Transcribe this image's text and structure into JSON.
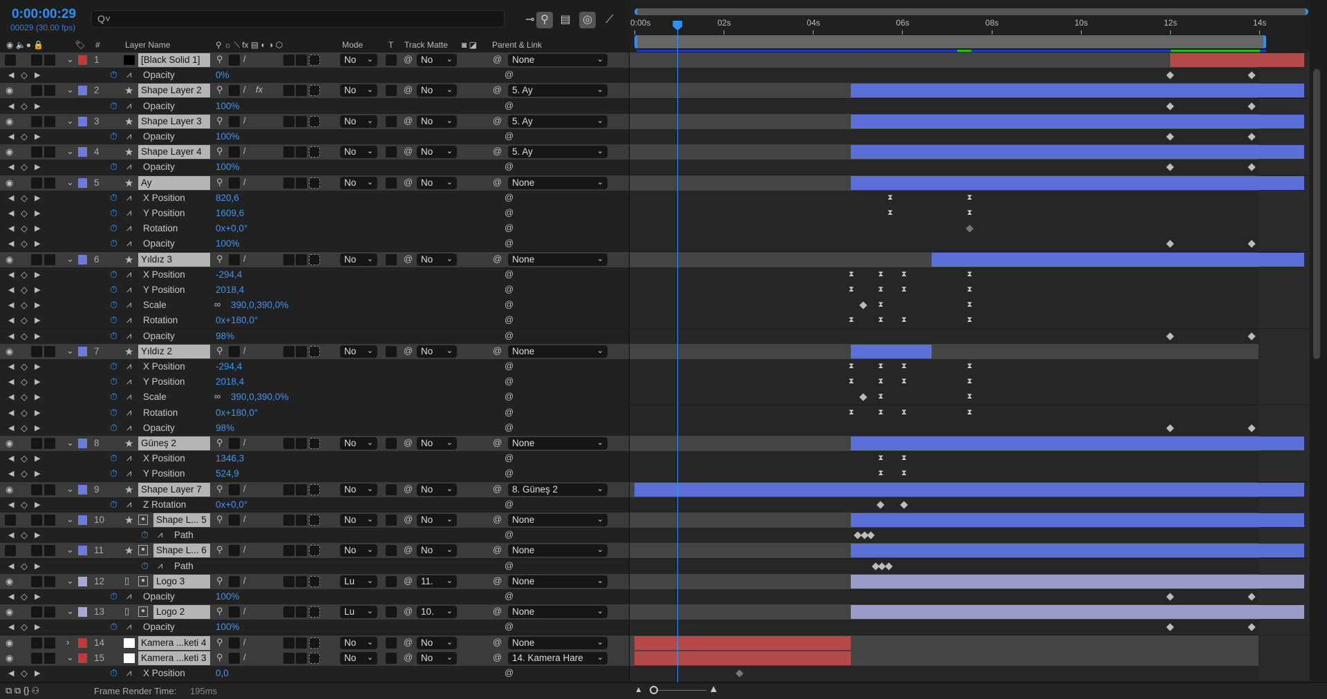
{
  "header": {
    "timecode": "0:00:00:29",
    "frames_fps": "00029 (30.00 fps)",
    "search_placeholder": "Q˅"
  },
  "columns": {
    "hash": "#",
    "layer_name": "Layer Name",
    "mode": "Mode",
    "t": "T",
    "track_matte": "Track Matte",
    "parent_link": "Parent & Link"
  },
  "ruler": {
    "labels": [
      "0:00s",
      "02s",
      "04s",
      "06s",
      "08s",
      "10s",
      "12s",
      "14s"
    ],
    "current_time_s": 0.967,
    "comp_end_s": 15
  },
  "colors": {
    "accent": "#2e8ff0",
    "red": "#b64848",
    "blue": "#5b6fd8",
    "lavender": "#9b9bc8"
  },
  "rows": [
    {
      "type": "layer",
      "num": "1",
      "name": "[Black Solid 1]",
      "label": "#c0393b",
      "src": "solid-black",
      "eye": false,
      "twirl": "v",
      "mode": "No",
      "matte": "No",
      "parent": "None",
      "bar": [
        12,
        15
      ],
      "barColor": "#b64848"
    },
    {
      "type": "prop",
      "name": "Opacity",
      "value": "0%",
      "keys": [
        [
          12,
          "d"
        ],
        [
          13.83,
          "d"
        ]
      ]
    },
    {
      "type": "layer",
      "num": "2",
      "name": "Shape Layer 2",
      "label": "#6b7be0",
      "src": "star",
      "eye": true,
      "twirl": "v",
      "mode": "No",
      "matte": "No",
      "parent": "5. Ay",
      "bar": [
        4.85,
        15
      ],
      "barColor": "#5b6fd8",
      "fx": true
    },
    {
      "type": "prop",
      "name": "Opacity",
      "value": "100%",
      "keys": [
        [
          12,
          "d"
        ],
        [
          13.83,
          "d"
        ]
      ]
    },
    {
      "type": "layer",
      "num": "3",
      "name": "Shape Layer 3",
      "label": "#6b7be0",
      "src": "star",
      "eye": true,
      "twirl": "v",
      "mode": "No",
      "matte": "No",
      "parent": "5. Ay",
      "bar": [
        4.85,
        15
      ],
      "barColor": "#5b6fd8"
    },
    {
      "type": "prop",
      "name": "Opacity",
      "value": "100%",
      "keys": [
        [
          12,
          "d"
        ],
        [
          13.83,
          "d"
        ]
      ]
    },
    {
      "type": "layer",
      "num": "4",
      "name": "Shape Layer 4",
      "label": "#6b7be0",
      "src": "star",
      "eye": true,
      "twirl": "v",
      "mode": "No",
      "matte": "No",
      "parent": "5. Ay",
      "bar": [
        4.85,
        15
      ],
      "barColor": "#5b6fd8"
    },
    {
      "type": "prop",
      "name": "Opacity",
      "value": "100%",
      "keys": [
        [
          12,
          "d"
        ],
        [
          13.83,
          "d"
        ]
      ]
    },
    {
      "type": "layer",
      "num": "5",
      "name": "Ay",
      "label": "#6b7be0",
      "src": "star",
      "eye": true,
      "twirl": "v",
      "mode": "No",
      "matte": "No",
      "parent": "None",
      "bar": [
        4.85,
        15
      ],
      "barColor": "#5b6fd8"
    },
    {
      "type": "prop",
      "name": "X Position",
      "value": "820,6",
      "keys": [
        [
          5.73,
          "h"
        ],
        [
          7.51,
          "h"
        ]
      ]
    },
    {
      "type": "prop",
      "name": "Y Position",
      "value": "1609,6",
      "keys": [
        [
          5.73,
          "h"
        ],
        [
          7.51,
          "h"
        ]
      ]
    },
    {
      "type": "prop",
      "name": "Rotation",
      "value": "0x+0,0°",
      "keys": [
        [
          7.51,
          "dg"
        ]
      ]
    },
    {
      "type": "prop",
      "name": "Opacity",
      "value": "100%",
      "keys": [
        [
          12,
          "d"
        ],
        [
          13.83,
          "d"
        ]
      ]
    },
    {
      "type": "layer",
      "num": "6",
      "name": "Yıldız 3",
      "label": "#6b7be0",
      "src": "star",
      "eye": true,
      "twirl": "v",
      "mode": "No",
      "matte": "No",
      "parent": "None",
      "bar": [
        6.66,
        15
      ],
      "barColor": "#5b6fd8"
    },
    {
      "type": "prop",
      "name": "X Position",
      "value": "-294,4",
      "keys": [
        [
          4.86,
          "h"
        ],
        [
          5.52,
          "h"
        ],
        [
          6.04,
          "h"
        ],
        [
          7.51,
          "h"
        ]
      ]
    },
    {
      "type": "prop",
      "name": "Y Position",
      "value": "2018,4",
      "keys": [
        [
          4.86,
          "h"
        ],
        [
          5.52,
          "h"
        ],
        [
          6.04,
          "h"
        ],
        [
          7.51,
          "h"
        ]
      ]
    },
    {
      "type": "prop",
      "name": "Scale",
      "value": "390,0,390,0%",
      "link": true,
      "keys": [
        [
          5.13,
          "d"
        ],
        [
          5.52,
          "h"
        ],
        [
          7.51,
          "h"
        ]
      ]
    },
    {
      "type": "prop",
      "name": "Rotation",
      "value": "0x+180,0°",
      "keys": [
        [
          4.86,
          "h"
        ],
        [
          5.52,
          "h"
        ],
        [
          6.04,
          "h"
        ],
        [
          7.51,
          "h"
        ]
      ]
    },
    {
      "type": "prop",
      "name": "Opacity",
      "value": "98%",
      "keys": [
        [
          12,
          "d"
        ],
        [
          13.83,
          "d"
        ]
      ]
    },
    {
      "type": "layer",
      "num": "7",
      "name": "Yıldız 2",
      "label": "#6b7be0",
      "src": "star",
      "eye": true,
      "twirl": "v",
      "mode": "No",
      "matte": "No",
      "parent": "None",
      "bar": [
        4.85,
        6.66
      ],
      "barColor": "#5b6fd8"
    },
    {
      "type": "prop",
      "name": "X Position",
      "value": "-294,4",
      "keys": [
        [
          4.86,
          "h"
        ],
        [
          5.52,
          "h"
        ],
        [
          6.04,
          "h"
        ],
        [
          7.51,
          "h"
        ]
      ]
    },
    {
      "type": "prop",
      "name": "Y Position",
      "value": "2018,4",
      "keys": [
        [
          4.86,
          "h"
        ],
        [
          5.52,
          "h"
        ],
        [
          6.04,
          "h"
        ],
        [
          7.51,
          "h"
        ]
      ]
    },
    {
      "type": "prop",
      "name": "Scale",
      "value": "390,0,390,0%",
      "link": true,
      "keys": [
        [
          5.13,
          "d"
        ],
        [
          5.52,
          "h"
        ],
        [
          7.51,
          "h"
        ]
      ]
    },
    {
      "type": "prop",
      "name": "Rotation",
      "value": "0x+180,0°",
      "keys": [
        [
          4.86,
          "h"
        ],
        [
          5.52,
          "h"
        ],
        [
          6.04,
          "h"
        ],
        [
          7.51,
          "h"
        ]
      ]
    },
    {
      "type": "prop",
      "name": "Opacity",
      "value": "98%",
      "keys": [
        [
          12,
          "d"
        ],
        [
          13.83,
          "d"
        ]
      ]
    },
    {
      "type": "layer",
      "num": "8",
      "name": "Güneş 2",
      "label": "#6b7be0",
      "src": "star",
      "eye": true,
      "twirl": "v",
      "mode": "No",
      "matte": "No",
      "parent": "None",
      "bar": [
        4.85,
        15
      ],
      "barColor": "#5b6fd8"
    },
    {
      "type": "prop",
      "name": "X Position",
      "value": "1346,3",
      "keys": [
        [
          5.52,
          "h"
        ],
        [
          6.04,
          "h"
        ]
      ]
    },
    {
      "type": "prop",
      "name": "Y Position",
      "value": "524,9",
      "keys": [
        [
          5.52,
          "h"
        ],
        [
          6.04,
          "h"
        ]
      ]
    },
    {
      "type": "layer",
      "num": "9",
      "name": "Shape Layer 7",
      "label": "#6b7be0",
      "src": "star",
      "eye": true,
      "twirl": "v",
      "mode": "No",
      "matte": "No",
      "parent": "8. Güneş 2",
      "bar": [
        0,
        15
      ],
      "barColor": "#5b6fd8"
    },
    {
      "type": "prop",
      "name": "Z Rotation",
      "value": "0x+0,0°",
      "keys": [
        [
          5.52,
          "d"
        ],
        [
          6.04,
          "d"
        ]
      ]
    },
    {
      "type": "layer",
      "num": "10",
      "name": "Shape L... 5",
      "label": "#6b7be0",
      "src": "star",
      "eye": false,
      "twirl": "v",
      "mode": "No",
      "matte": "No",
      "parent": "None",
      "bar": [
        4.85,
        15
      ],
      "barColor": "#5b6fd8"
    },
    {
      "type": "prop",
      "name": "Path",
      "value": "",
      "nested": true,
      "keys": [
        [
          5.0,
          "d"
        ],
        [
          5.15,
          "d"
        ],
        [
          5.3,
          "d"
        ]
      ]
    },
    {
      "type": "layer",
      "num": "11",
      "name": "Shape L... 6",
      "label": "#6b7be0",
      "src": "star",
      "eye": false,
      "twirl": "v",
      "mode": "No",
      "matte": "No",
      "parent": "None",
      "bar": [
        4.85,
        15
      ],
      "barColor": "#5b6fd8"
    },
    {
      "type": "prop",
      "name": "Path",
      "value": "",
      "nested": true,
      "keys": [
        [
          5.4,
          "d"
        ],
        [
          5.55,
          "d"
        ],
        [
          5.7,
          "d"
        ]
      ]
    },
    {
      "type": "layer",
      "num": "12",
      "name": "Logo 3",
      "label": "#a8a8d8",
      "src": "file",
      "eye": true,
      "twirl": "v",
      "mode": "Lu",
      "matte": "11.",
      "parent": "None",
      "bar": [
        4.85,
        15
      ],
      "barColor": "#9b9bc8"
    },
    {
      "type": "prop",
      "name": "Opacity",
      "value": "100%",
      "keys": [
        [
          12,
          "d"
        ],
        [
          13.83,
          "d"
        ]
      ]
    },
    {
      "type": "layer",
      "num": "13",
      "name": "Logo 2",
      "label": "#a8a8d8",
      "src": "file",
      "eye": true,
      "twirl": "v",
      "mode": "Lu",
      "matte": "10.",
      "parent": "None",
      "bar": [
        4.85,
        15
      ],
      "barColor": "#9b9bc8"
    },
    {
      "type": "prop",
      "name": "Opacity",
      "value": "100%",
      "keys": [
        [
          12,
          "d"
        ],
        [
          13.83,
          "d"
        ]
      ]
    },
    {
      "type": "layer",
      "num": "14",
      "name": "Kamera ...keti 4",
      "label": "#c0393b",
      "src": "solid-white",
      "eye": true,
      "twirl": ">",
      "mode": "No",
      "matte": "No",
      "parent": "None",
      "bar": [
        0,
        4.85
      ],
      "barColor": "#b64848"
    },
    {
      "type": "layer",
      "num": "15",
      "name": "Kamera ...keti 3",
      "label": "#c0393b",
      "src": "solid-white",
      "eye": true,
      "twirl": "v",
      "mode": "No",
      "matte": "No",
      "parent": "14. Kamera Hare",
      "bar": [
        0,
        4.85
      ],
      "barColor": "#b64848"
    },
    {
      "type": "prop",
      "name": "X Position",
      "value": "0,0",
      "keys": [
        [
          2.36,
          "dg"
        ]
      ]
    }
  ],
  "footer": {
    "frame_render_label": "Frame Render Time:",
    "frame_render_value": "195ms"
  }
}
